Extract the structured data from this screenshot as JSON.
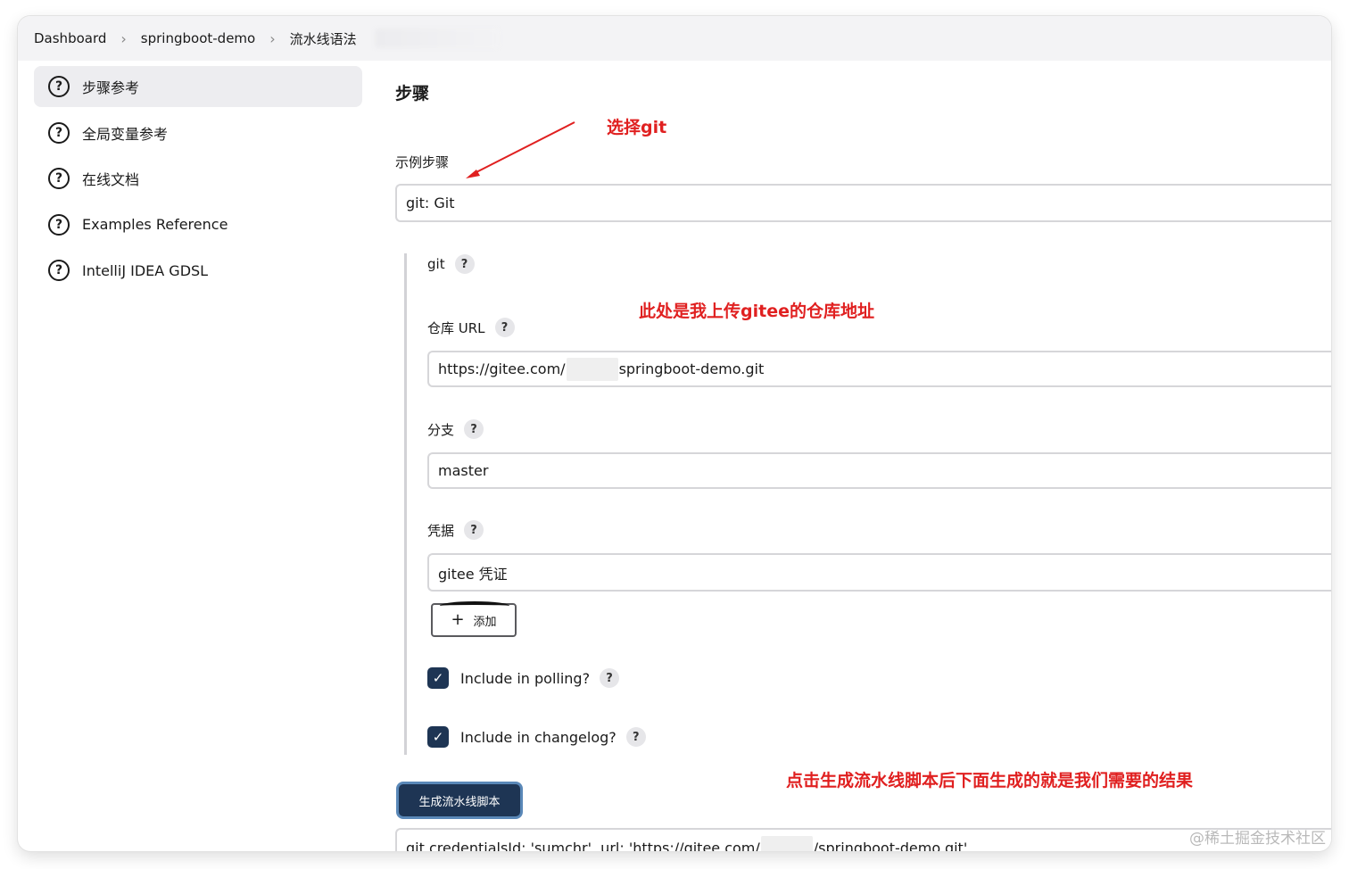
{
  "breadcrumb": {
    "items": [
      "Dashboard",
      "springboot-demo",
      "流水线语法"
    ]
  },
  "sidebar": {
    "items": [
      {
        "label": "步骤参考",
        "active": true
      },
      {
        "label": "全局变量参考"
      },
      {
        "label": "在线文档"
      },
      {
        "label": "Examples Reference"
      },
      {
        "label": "IntelliJ IDEA GDSL"
      }
    ]
  },
  "main": {
    "title": "步骤",
    "sample_step_label": "示例步骤",
    "sample_step_value": "git: Git",
    "git_label": "git",
    "repo_url_label": "仓库 URL",
    "repo_url_prefix": "https://gitee.com/",
    "repo_url_suffix": "springboot-demo.git",
    "branch_label": "分支",
    "branch_value": "master",
    "credentials_label": "凭据",
    "credentials_value": "gitee 凭证",
    "add_button": "添加",
    "include_polling": "Include in polling?",
    "include_changelog": "Include in changelog?",
    "generate_button": "生成流水线脚本",
    "script_prefix": "git credentialsId: 'sumchr', url: 'https://gitee.com/",
    "script_suffix": "/springboot-demo.git'"
  },
  "annotations": {
    "select_git": "选择git",
    "repo_note": "此处是我上传gitee的仓库地址",
    "result_note": "点击生成流水线脚本后下面生成的就是我们需要的结果"
  },
  "watermark": "@稀土掘金技术社区",
  "colors": {
    "accent": "#1e3554",
    "annotation": "#e02020"
  }
}
